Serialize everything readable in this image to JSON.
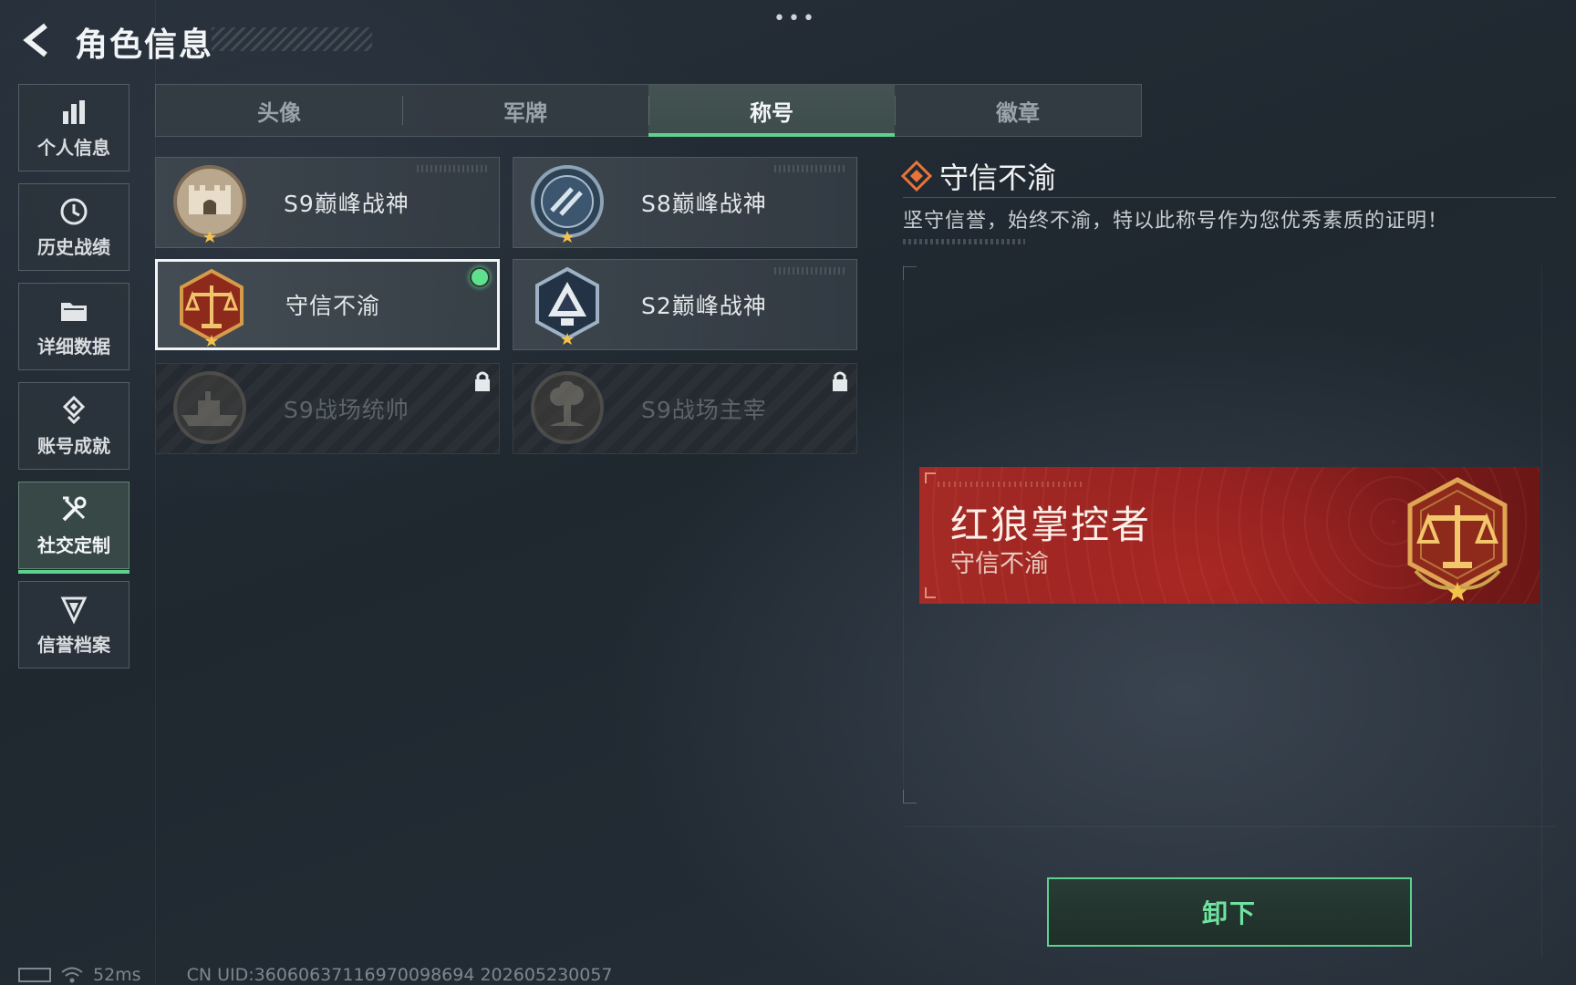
{
  "header": {
    "title": "角色信息",
    "more_icon": "more-dots-icon"
  },
  "sidebar": {
    "items": [
      {
        "label": "个人信息",
        "icon": "bar-chart-icon",
        "active": false
      },
      {
        "label": "历史战绩",
        "icon": "clock-history-icon",
        "active": false
      },
      {
        "label": "详细数据",
        "icon": "folder-icon",
        "active": false
      },
      {
        "label": "账号成就",
        "icon": "achievement-medal-icon",
        "active": false
      },
      {
        "label": "社交定制",
        "icon": "tools-icon",
        "active": true
      },
      {
        "label": "信誉档案",
        "icon": "credit-shield-icon",
        "active": false
      }
    ]
  },
  "tabs": [
    {
      "label": "头像",
      "active": false
    },
    {
      "label": "军牌",
      "active": false
    },
    {
      "label": "称号",
      "active": true
    },
    {
      "label": "徽章",
      "active": false
    }
  ],
  "titles": [
    {
      "label": "S9巅峰战神",
      "emblem": "fortress-emblem-icon",
      "state": "normal"
    },
    {
      "label": "S8巅峰战神",
      "emblem": "blue-stripe-emblem-icon",
      "state": "normal"
    },
    {
      "label": "守信不渝",
      "emblem": "justice-scale-emblem-icon",
      "state": "equipped"
    },
    {
      "label": "S2巅峰战神",
      "emblem": "navy-crest-emblem-icon",
      "state": "normal"
    },
    {
      "label": "S9战场统帅",
      "emblem": "warship-emblem-icon",
      "state": "locked"
    },
    {
      "label": "S9战场主宰",
      "emblem": "explosion-emblem-icon",
      "state": "locked"
    }
  ],
  "detail": {
    "title": "守信不渝",
    "description": "坚守信誉，始终不渝，特以此称号作为您优秀素质的证明！",
    "title_icon": "diamond-badge-icon"
  },
  "banner": {
    "player_name": "红狼掌控者",
    "title": "守信不渝",
    "emblem": "justice-scale-emblem-icon"
  },
  "actions": {
    "unequip_label": "卸下"
  },
  "footer": {
    "ping": "52ms",
    "uid": "CN UID:3606063711697009​8694  202605230057"
  },
  "colors": {
    "accent": "#5fd18e",
    "banner_red": "#a62b26",
    "bg": "#242c35"
  }
}
